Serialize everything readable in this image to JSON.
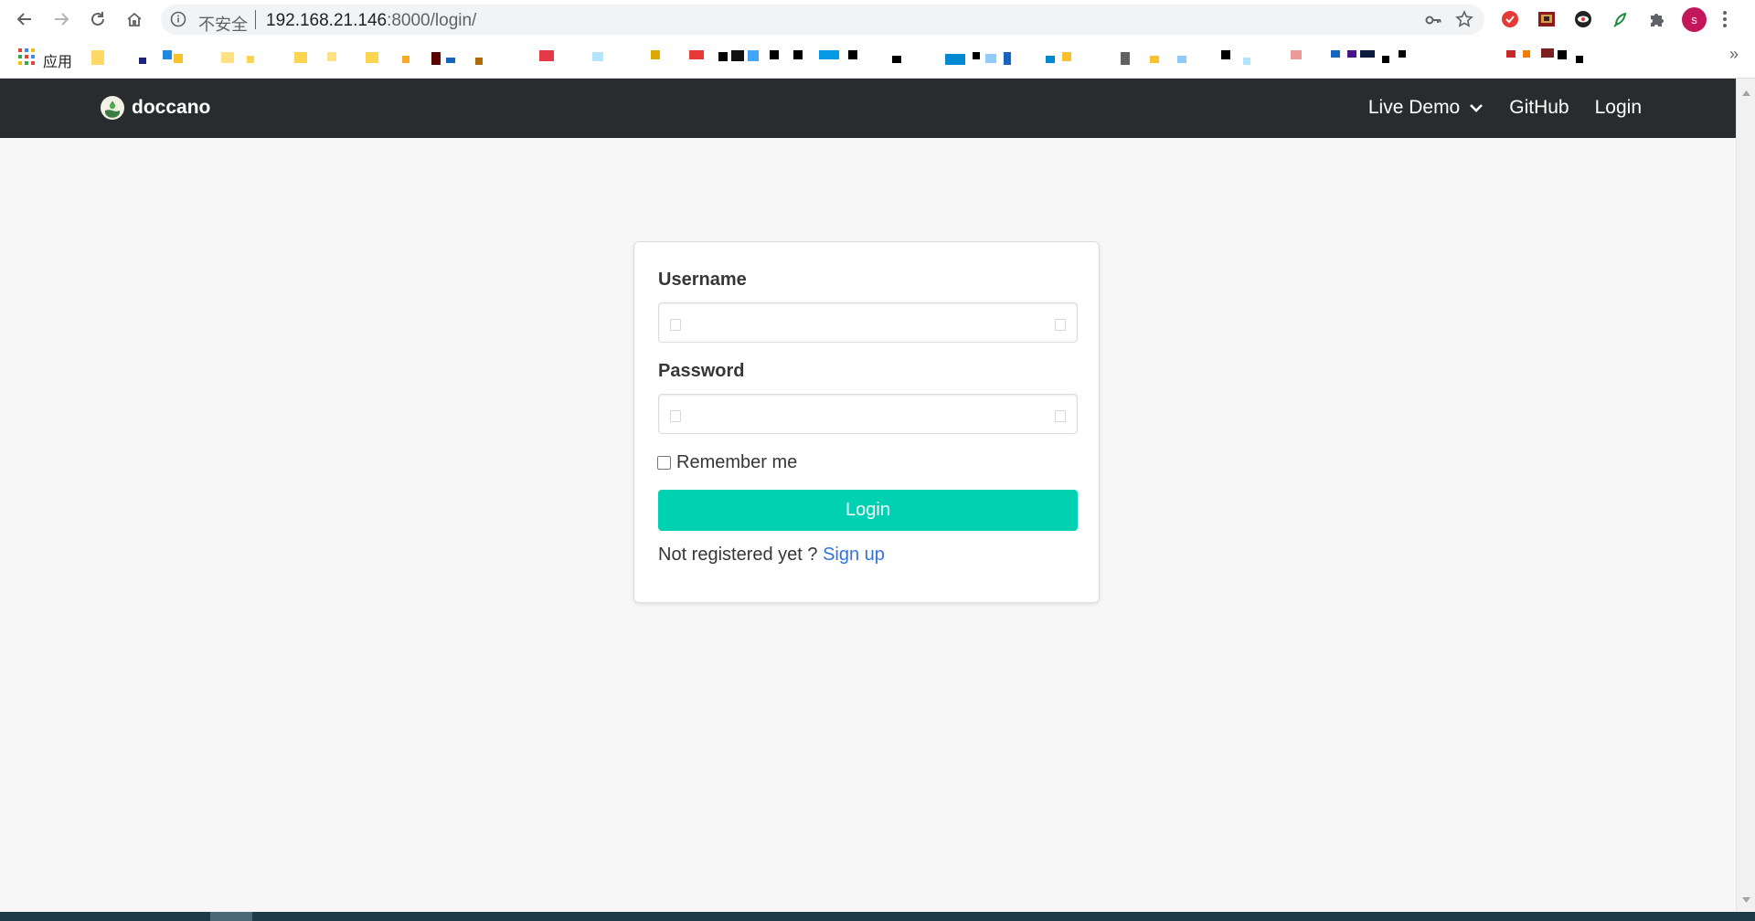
{
  "browser": {
    "security_label": "不安全",
    "url_host": "192.168.21.146",
    "url_rest": ":8000/login/",
    "apps_label": "应用",
    "bookmarks_more": "»",
    "profile_initial": "s",
    "icons": {
      "back": "back-arrow-icon",
      "forward": "forward-arrow-icon",
      "reload": "reload-icon",
      "home": "home-icon",
      "info": "info-icon",
      "key": "key-icon",
      "star": "star-icon",
      "apps": "apps-grid-icon",
      "extensions": "puzzle-icon",
      "menu": "more-vertical-icon"
    }
  },
  "navbar": {
    "brand": "doccano",
    "links": {
      "live_demo": "Live Demo",
      "github": "GitHub",
      "login": "Login"
    }
  },
  "form": {
    "username_label": "Username",
    "username_value": "",
    "password_label": "Password",
    "password_value": "",
    "remember_label": "Remember me",
    "remember_checked": false,
    "submit_label": "Login",
    "not_registered": "Not registered yet ? ",
    "signup_link": "Sign up"
  },
  "colors": {
    "navbar_bg": "#292c2f",
    "primary": "#00d1b2",
    "link": "#3273dc",
    "page_bg": "#f7f7f7"
  }
}
